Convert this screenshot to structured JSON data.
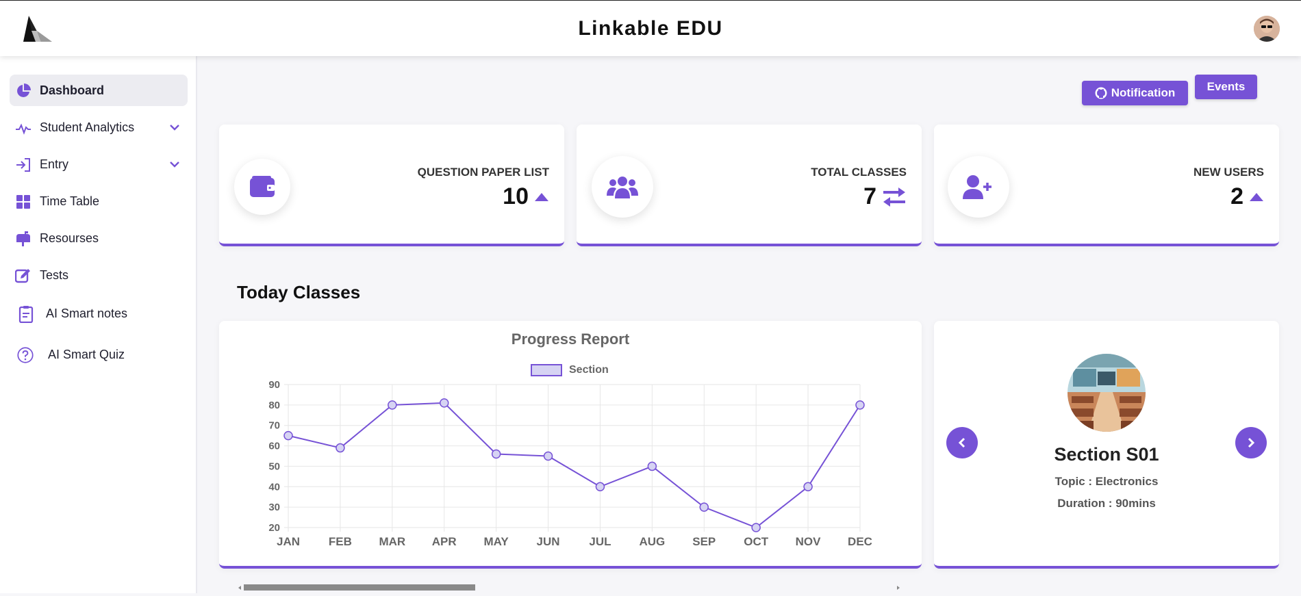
{
  "header": {
    "title": "Linkable EDU",
    "logo_icon": "triangle-logo-icon",
    "avatar_icon": "user-avatar-icon"
  },
  "sidebar": {
    "items": [
      {
        "label": "Dashboard",
        "icon": "pie-chart-icon",
        "active": true
      },
      {
        "label": "Student Analytics",
        "icon": "pulse-icon",
        "has_submenu": true
      },
      {
        "label": "Entry",
        "icon": "sign-in-icon",
        "has_submenu": true
      },
      {
        "label": "Time Table",
        "icon": "grid-icon"
      },
      {
        "label": "Resourses",
        "icon": "mailbox-icon"
      },
      {
        "label": "Tests",
        "icon": "pen-square-icon"
      },
      {
        "label": "AI Smart notes",
        "icon": "clipboard-icon"
      },
      {
        "label": "AI Smart Quiz",
        "icon": "question-circle-icon"
      }
    ]
  },
  "actions": {
    "notification_label": "Notification",
    "notification_icon": "github-icon",
    "events_label": "Events"
  },
  "stats": [
    {
      "title": "QUESTION PAPER LIST",
      "value": "10",
      "icon": "wallet-icon",
      "trend_icon": "caret-up-icon"
    },
    {
      "title": "TOTAL CLASSES",
      "value": "7",
      "icon": "users-icon",
      "trend_icon": "exchange-arrows-icon"
    },
    {
      "title": "NEW USERS",
      "value": "2",
      "icon": "user-plus-icon",
      "trend_icon": "caret-up-icon"
    }
  ],
  "section_title": "Today Classes",
  "chart_data": {
    "type": "line",
    "title": "Progress Report",
    "categories": [
      "JAN",
      "FEB",
      "MAR",
      "APR",
      "MAY",
      "JUN",
      "JUL",
      "AUG",
      "SEP",
      "OCT",
      "NOV",
      "DEC"
    ],
    "series": [
      {
        "name": "Section",
        "values": [
          65,
          59,
          80,
          81,
          56,
          55,
          40,
          50,
          30,
          20,
          40,
          80
        ]
      }
    ],
    "ylim": [
      20,
      90
    ],
    "yticks": [
      20,
      30,
      40,
      50,
      60,
      70,
      80,
      90
    ],
    "grid": true,
    "legend": "top-center",
    "colors": {
      "line": "#7652d6",
      "point_fill": "#d6d3f3",
      "grid": "#e6e6e6",
      "tick": "#666666"
    }
  },
  "carousel": {
    "name": "Section S01",
    "topic": "Topic : Electronics",
    "duration": "Duration : 90mins",
    "prev_icon": "chevron-left-icon",
    "next_icon": "chevron-right-icon",
    "image_icon": "classroom-image-icon"
  },
  "colors": {
    "accent": "#7652d6",
    "background": "#f6f6f9"
  }
}
